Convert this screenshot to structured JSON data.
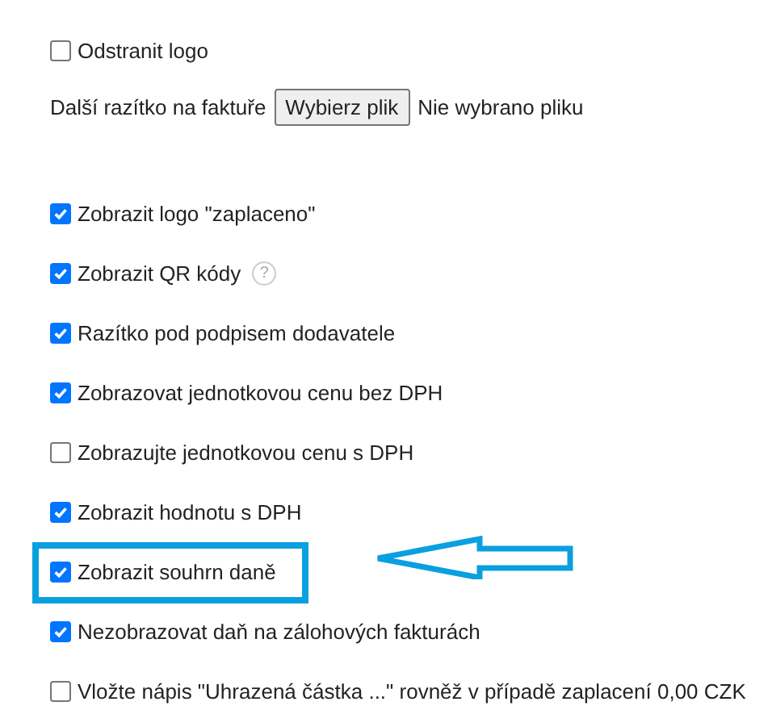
{
  "remove_logo": {
    "label": "Odstranit logo",
    "checked": false
  },
  "stamp": {
    "label": "Další razítko na faktuře",
    "button": "Wybierz plik",
    "status": "Nie wybrano pliku"
  },
  "options": [
    {
      "label": "Zobrazit logo \"zaplaceno\"",
      "checked": true,
      "highlighted": false
    },
    {
      "label": "Zobrazit QR kódy",
      "checked": true,
      "highlighted": false,
      "help": "?"
    },
    {
      "label": "Razítko pod podpisem dodavatele",
      "checked": true,
      "highlighted": false
    },
    {
      "label": "Zobrazovat jednotkovou cenu bez DPH",
      "checked": true,
      "highlighted": false
    },
    {
      "label": "Zobrazujte jednotkovou cenu s DPH",
      "checked": false,
      "highlighted": false
    },
    {
      "label": "Zobrazit hodnotu s DPH",
      "checked": true,
      "highlighted": false
    },
    {
      "label": "Zobrazit souhrn daně",
      "checked": true,
      "highlighted": true
    },
    {
      "label": "Nezobrazovat daň na zálohových fakturách",
      "checked": true,
      "highlighted": false
    },
    {
      "label": "Vložte nápis \"Uhrazená částka ...\" rovněž v případě zaplacení 0,00 CZK",
      "checked": false,
      "highlighted": false
    }
  ]
}
